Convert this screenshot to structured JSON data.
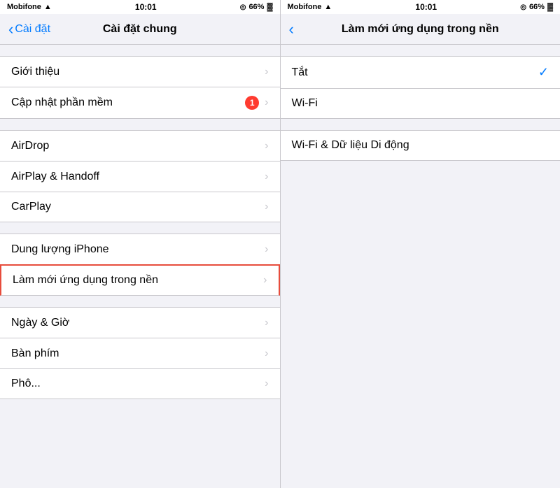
{
  "left_panel": {
    "status": {
      "carrier": "Mobifone",
      "wifi": "wifi",
      "time": "10:01",
      "location": "◎",
      "battery_pct": "66%",
      "battery_icon": "🔋"
    },
    "nav": {
      "back_label": "Cài đặt",
      "title": "Cài đặt chung"
    },
    "sections": [
      {
        "items": [
          {
            "label": "Giới thiệu",
            "badge": null,
            "chevron": true
          },
          {
            "label": "Cập nhật phần mềm",
            "badge": "1",
            "chevron": true
          }
        ]
      },
      {
        "items": [
          {
            "label": "AirDrop",
            "badge": null,
            "chevron": true
          },
          {
            "label": "AirPlay & Handoff",
            "badge": null,
            "chevron": true
          },
          {
            "label": "CarPlay",
            "badge": null,
            "chevron": true
          }
        ]
      },
      {
        "items": [
          {
            "label": "Dung lượng iPhone",
            "badge": null,
            "chevron": true
          },
          {
            "label": "Làm mới ứng dụng trong nền",
            "badge": null,
            "chevron": true,
            "highlighted": true
          }
        ]
      },
      {
        "items": [
          {
            "label": "Ngày & Giờ",
            "badge": null,
            "chevron": true
          },
          {
            "label": "Bàn phím",
            "badge": null,
            "chevron": true
          },
          {
            "label": "Phô...",
            "badge": null,
            "chevron": true
          }
        ]
      }
    ]
  },
  "right_panel": {
    "status": {
      "carrier": "Mobifone",
      "wifi": "wifi",
      "time": "10:01",
      "location": "◎",
      "battery_pct": "66%"
    },
    "nav": {
      "back_chevron": "‹",
      "title": "Làm mới ứng dụng trong nền"
    },
    "options": [
      {
        "label": "Tắt",
        "selected": true
      },
      {
        "label": "Wi-Fi",
        "selected": false
      }
    ],
    "plain_option": "Wi-Fi & Dữ liệu Di động"
  },
  "icons": {
    "chevron": "›",
    "back_chevron": "‹",
    "checkmark": "✓",
    "wifi": "wifi"
  }
}
